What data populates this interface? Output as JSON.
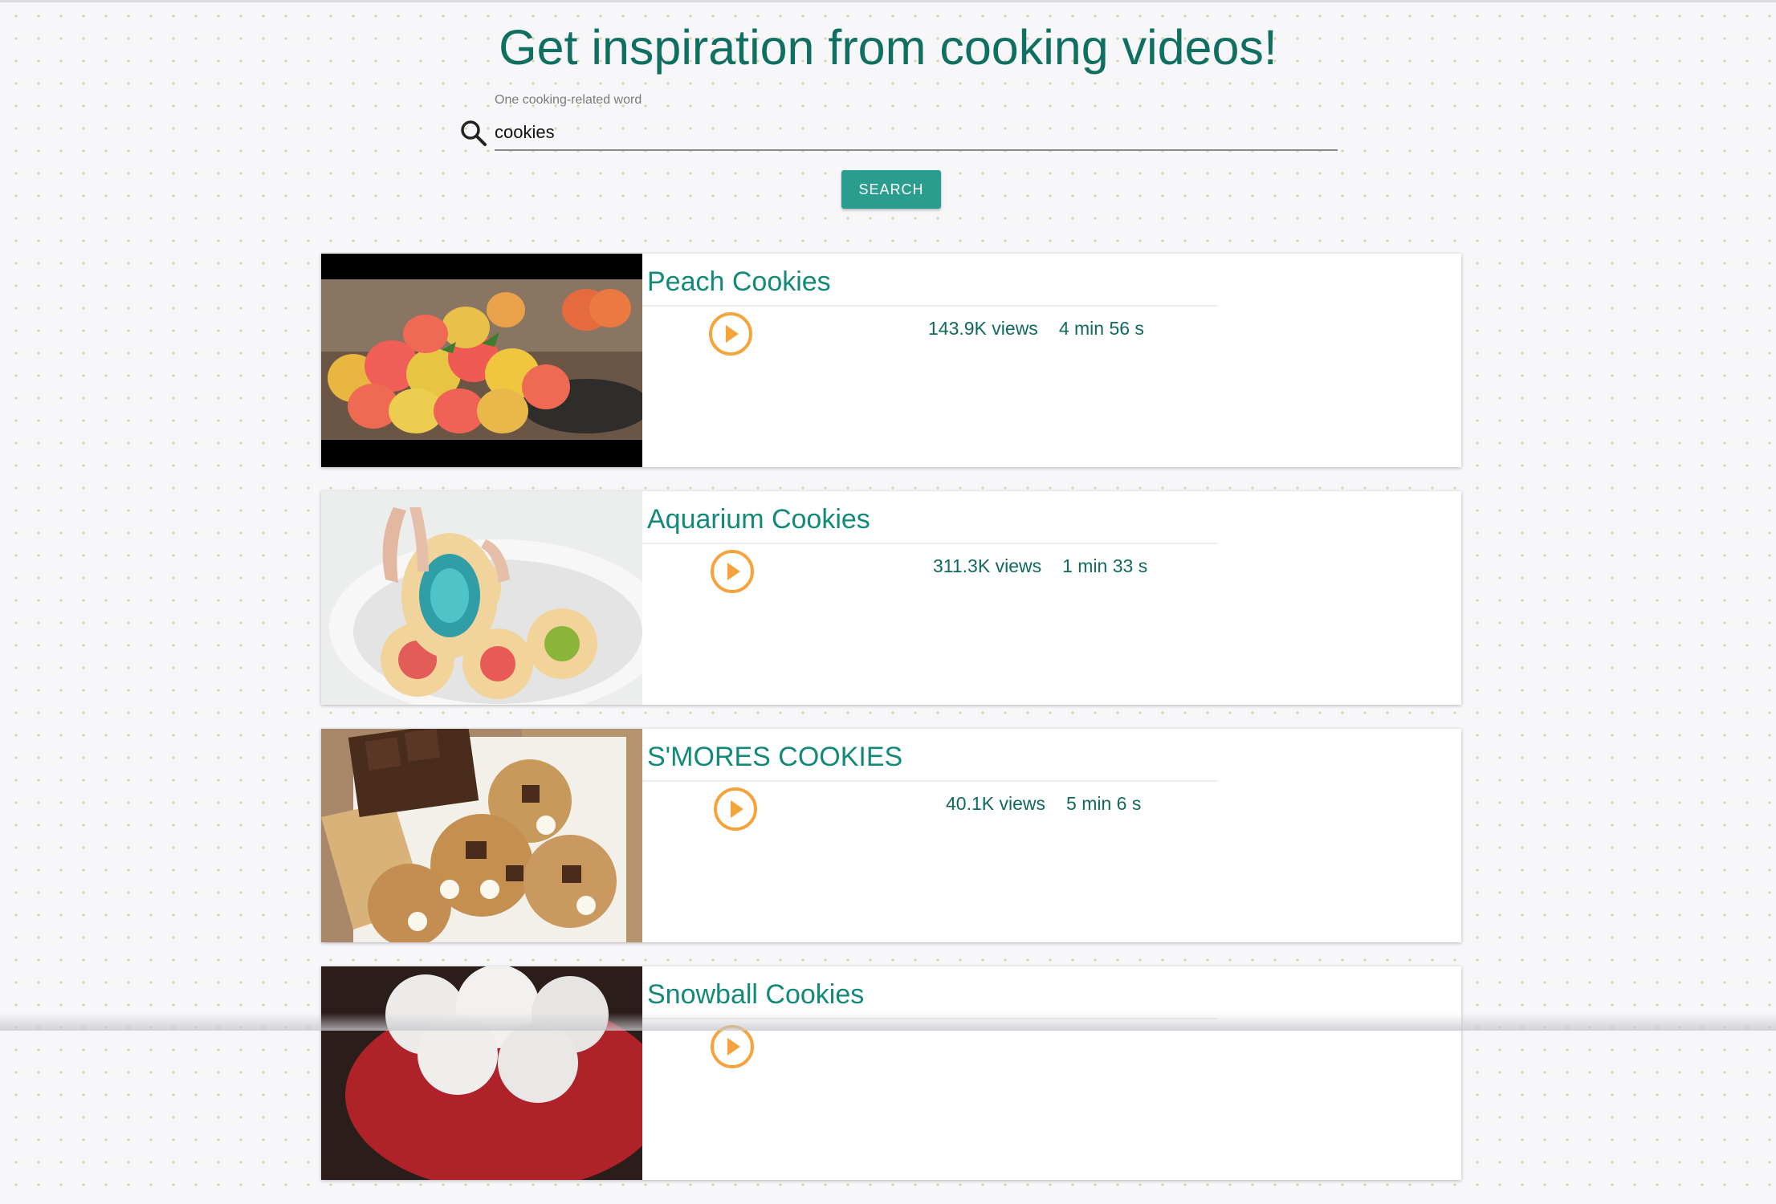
{
  "header": {
    "title": "Get inspiration from cooking videos!"
  },
  "search": {
    "label": "One cooking-related word",
    "value": "cookies",
    "button_label": "SEARCH",
    "icon": "search-icon"
  },
  "videos": [
    {
      "title": "Peach Cookies",
      "views": "143.9K views",
      "duration": "4 min 56 s",
      "thumbnail": "peach-cookies-photo",
      "play_icon": "play-circle-icon"
    },
    {
      "title": "Aquarium Cookies",
      "views": "311.3K views",
      "duration": "1 min 33 s",
      "thumbnail": "aquarium-cookies-photo",
      "play_icon": "play-circle-icon"
    },
    {
      "title": "S'MORES COOKIES",
      "views": "40.1K views",
      "duration": "5 min 6 s",
      "thumbnail": "smores-cookies-photo",
      "play_icon": "play-circle-icon"
    },
    {
      "title": "Snowball Cookies",
      "views": "",
      "duration": "",
      "thumbnail": "snowball-cookies-photo",
      "play_icon": "play-circle-icon"
    }
  ],
  "colors": {
    "accent": "#2a9d8f",
    "title_text": "#0f6f60",
    "play_icon": "#f4a43a"
  }
}
